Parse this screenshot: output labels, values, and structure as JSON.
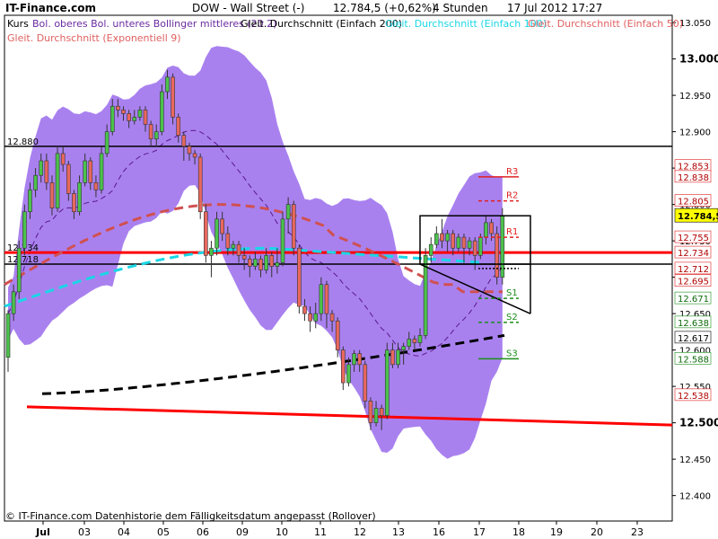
{
  "header": {
    "brand": "IT-Finance.com",
    "instrument": "DOW - Wall Street (-)",
    "quote": "12.784,5 (+0,62%)",
    "interval": "4 Stunden",
    "datetime": "17 Jul 2012 17:27"
  },
  "legend": [
    {
      "label": "Kurs",
      "color": "#000000"
    },
    {
      "label": "Bol. oberes Bol. unteres Bollinger mittleres (20 2)",
      "color": "#7e2fb3"
    },
    {
      "label": "Gleit. Durchschnitt (Einfach 200)",
      "color": "#000000"
    },
    {
      "label": "Gleit. Durchschnitt (Einfach 100)",
      "color": "#19d7e6"
    },
    {
      "label": "Gleit. Durchschnitt (Einfach 50)",
      "color": "#d05050"
    },
    {
      "label": "Gleit. Durchschnitt (Exponentiell 9)",
      "color": "#e07070"
    }
  ],
  "footer": {
    "copyright": "© IT-Finance.com  Datenhistorie dem Fälligkeitsdatum angepasst (Rollover)"
  },
  "colors": {
    "bollinger_fill": "#a981ef",
    "up_candle": "#4cc24c",
    "down_candle": "#e8685e",
    "sma200": "#000000",
    "sma100": "#19d7e6",
    "sma50": "#d05050",
    "support": "#1a8f1a",
    "resistance": "#e02020",
    "hline_red": "#ff0000",
    "last_price_bg": "#ffff00"
  },
  "chart_data": {
    "type": "candlestick",
    "y_range": [
      12365,
      13060
    ],
    "yticks": [
      "13.050",
      "13.000",
      "12.950",
      "12.900",
      "12.850",
      "12.800",
      "12.750",
      "12.700",
      "12.650",
      "12.600",
      "12.550",
      "12.500",
      "12.450",
      "12.400"
    ],
    "yticks_bold": [
      "13.000",
      "12.500"
    ],
    "x_labels": [
      "Jul",
      "03",
      "04",
      "05",
      "06",
      "09",
      "10",
      "11",
      "12",
      "13",
      "16",
      "17",
      "18",
      "19",
      "20",
      "23"
    ],
    "right_labels": [
      {
        "text": "12.853",
        "value": 12853,
        "color": "red"
      },
      {
        "text": "12.838",
        "value": 12838,
        "color": "red"
      },
      {
        "text": "12.805",
        "value": 12805,
        "color": "red"
      },
      {
        "text": "12.784,5",
        "value": 12784.5,
        "color": "black",
        "highlight": true
      },
      {
        "text": "12.755",
        "value": 12755,
        "color": "red"
      },
      {
        "text": "12.734",
        "value": 12734,
        "color": "red"
      },
      {
        "text": "12.712",
        "value": 12712,
        "color": "red"
      },
      {
        "text": "12.695",
        "value": 12695,
        "color": "red"
      },
      {
        "text": "12.671",
        "value": 12671,
        "color": "green"
      },
      {
        "text": "12.638",
        "value": 12638,
        "color": "green"
      },
      {
        "text": "12.617",
        "value": 12617,
        "color": "black"
      },
      {
        "text": "12.588",
        "value": 12588,
        "color": "green"
      },
      {
        "text": "12.538",
        "value": 12538,
        "color": "red"
      }
    ],
    "horizontal_lines": [
      {
        "value": 12880,
        "label": "12.880",
        "color": "black"
      },
      {
        "value": 12734,
        "label": "12.734",
        "color": "red"
      },
      {
        "value": 12718,
        "label": "12.718",
        "color": "black"
      }
    ],
    "pivot_levels": [
      {
        "label": "R3",
        "value": 12838,
        "kind": "resistance",
        "style": "solid"
      },
      {
        "label": "R2",
        "value": 12805,
        "kind": "resistance",
        "style": "dashed"
      },
      {
        "label": "R1",
        "value": 12755,
        "kind": "resistance",
        "style": "dashed"
      },
      {
        "label": "S1",
        "value": 12671,
        "kind": "support",
        "style": "dashed"
      },
      {
        "label": "S2",
        "value": 12638,
        "kind": "support",
        "style": "dashed"
      },
      {
        "label": "S3",
        "value": 12588,
        "kind": "support",
        "style": "solid"
      }
    ],
    "pivot_point": 12712,
    "candles": [
      [
        12590,
        12650,
        12570,
        12655
      ],
      [
        12650,
        12680,
        12640,
        12690
      ],
      [
        12680,
        12740,
        12670,
        12750
      ],
      [
        12740,
        12790,
        12730,
        12800
      ],
      [
        12790,
        12820,
        12780,
        12830
      ],
      [
        12820,
        12840,
        12810,
        12850
      ],
      [
        12840,
        12860,
        12830,
        12870
      ],
      [
        12860,
        12830,
        12820,
        12870
      ],
      [
        12830,
        12795,
        12785,
        12840
      ],
      [
        12795,
        12870,
        12790,
        12880
      ],
      [
        12870,
        12855,
        12845,
        12880
      ],
      [
        12855,
        12815,
        12805,
        12860
      ],
      [
        12815,
        12790,
        12780,
        12820
      ],
      [
        12790,
        12830,
        12785,
        12840
      ],
      [
        12830,
        12860,
        12825,
        12870
      ],
      [
        12860,
        12830,
        12820,
        12865
      ],
      [
        12830,
        12820,
        12810,
        12840
      ],
      [
        12820,
        12870,
        12815,
        12880
      ],
      [
        12870,
        12900,
        12865,
        12910
      ],
      [
        12900,
        12935,
        12895,
        12945
      ],
      [
        12935,
        12930,
        12920,
        12945
      ],
      [
        12930,
        12925,
        12915,
        12935
      ],
      [
        12925,
        12915,
        12905,
        12930
      ],
      [
        12915,
        12920,
        12910,
        12930
      ],
      [
        12920,
        12930,
        12915,
        12935
      ],
      [
        12930,
        12910,
        12900,
        12935
      ],
      [
        12910,
        12890,
        12880,
        12915
      ],
      [
        12890,
        12900,
        12880,
        12910
      ],
      [
        12900,
        12955,
        12895,
        12965
      ],
      [
        12955,
        12975,
        12945,
        12985
      ],
      [
        12975,
        12920,
        12910,
        12980
      ],
      [
        12920,
        12895,
        12885,
        12925
      ],
      [
        12895,
        12880,
        12860,
        12900
      ],
      [
        12880,
        12870,
        12860,
        12885
      ],
      [
        12870,
        12865,
        12855,
        12875
      ],
      [
        12865,
        12790,
        12780,
        12870
      ],
      [
        12790,
        12730,
        12720,
        12800
      ],
      [
        12730,
        12740,
        12700,
        12750
      ],
      [
        12740,
        12780,
        12730,
        12790
      ],
      [
        12780,
        12760,
        12750,
        12790
      ],
      [
        12760,
        12740,
        12730,
        12770
      ],
      [
        12740,
        12745,
        12730,
        12750
      ],
      [
        12745,
        12730,
        12720,
        12750
      ],
      [
        12730,
        12725,
        12710,
        12740
      ],
      [
        12725,
        12715,
        12700,
        12730
      ],
      [
        12715,
        12725,
        12710,
        12735
      ],
      [
        12725,
        12710,
        12700,
        12730
      ],
      [
        12710,
        12730,
        12705,
        12740
      ],
      [
        12730,
        12715,
        12700,
        12735
      ],
      [
        12715,
        12720,
        12705,
        12740
      ],
      [
        12720,
        12780,
        12715,
        12790
      ],
      [
        12780,
        12800,
        12760,
        12810
      ],
      [
        12800,
        12740,
        12730,
        12805
      ],
      [
        12740,
        12660,
        12650,
        12745
      ],
      [
        12660,
        12650,
        12640,
        12670
      ],
      [
        12650,
        12640,
        12625,
        12660
      ],
      [
        12640,
        12650,
        12630,
        12665
      ],
      [
        12650,
        12690,
        12640,
        12700
      ],
      [
        12690,
        12650,
        12630,
        12695
      ],
      [
        12650,
        12640,
        12625,
        12655
      ],
      [
        12640,
        12600,
        12590,
        12645
      ],
      [
        12600,
        12555,
        12545,
        12605
      ],
      [
        12555,
        12580,
        12550,
        12590
      ],
      [
        12580,
        12595,
        12570,
        12600
      ],
      [
        12595,
        12580,
        12570,
        12600
      ],
      [
        12580,
        12530,
        12520,
        12585
      ],
      [
        12530,
        12500,
        12490,
        12535
      ],
      [
        12500,
        12520,
        12495,
        12530
      ],
      [
        12520,
        12510,
        12490,
        12525
      ],
      [
        12510,
        12600,
        12505,
        12610
      ],
      [
        12600,
        12580,
        12575,
        12610
      ],
      [
        12580,
        12600,
        12575,
        12610
      ],
      [
        12600,
        12605,
        12580,
        12610
      ],
      [
        12605,
        12615,
        12600,
        12625
      ],
      [
        12615,
        12610,
        12600,
        12620
      ],
      [
        12610,
        12620,
        12605,
        12630
      ],
      [
        12620,
        12730,
        12615,
        12740
      ],
      [
        12730,
        12745,
        12720,
        12755
      ],
      [
        12745,
        12760,
        12740,
        12770
      ],
      [
        12760,
        12750,
        12740,
        12780
      ],
      [
        12750,
        12760,
        12735,
        12765
      ],
      [
        12760,
        12740,
        12730,
        12765
      ],
      [
        12740,
        12755,
        12735,
        12760
      ],
      [
        12755,
        12740,
        12720,
        12760
      ],
      [
        12740,
        12750,
        12730,
        12755
      ],
      [
        12750,
        12730,
        12710,
        12755
      ],
      [
        12730,
        12755,
        12725,
        12760
      ],
      [
        12755,
        12775,
        12745,
        12785
      ],
      [
        12775,
        12760,
        12750,
        12780
      ],
      [
        12760,
        12700,
        12690,
        12770
      ],
      [
        12700,
        12784.5,
        12690,
        12795
      ]
    ]
  }
}
